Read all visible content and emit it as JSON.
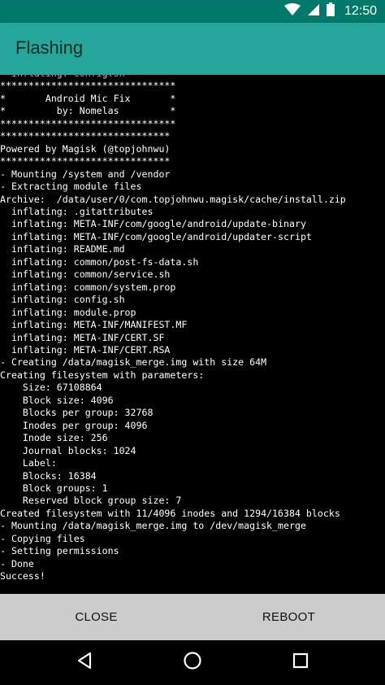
{
  "status_bar": {
    "time": "12:50",
    "icons": [
      "wifi-icon",
      "signal-icon",
      "battery-icon"
    ],
    "color": "#00796b"
  },
  "app_bar": {
    "title": "Flashing",
    "color": "#26a69a"
  },
  "console": {
    "text": "  inflating: config.sh\n*******************************\n*       Android Mic Fix       *\n*         by: Nomelas         *\n*******************************\n******************************\nPowered by Magisk (@topjohnwu)\n******************************\n- Mounting /system and /vendor\n- Extracting module files\nArchive:  /data/user/0/com.topjohnwu.magisk/cache/install.zip\n  inflating: .gitattributes\n  inflating: META-INF/com/google/android/update-binary\n  inflating: META-INF/com/google/android/updater-script\n  inflating: README.md\n  inflating: common/post-fs-data.sh\n  inflating: common/service.sh\n  inflating: common/system.prop\n  inflating: config.sh\n  inflating: module.prop\n  inflating: META-INF/MANIFEST.MF\n  inflating: META-INF/CERT.SF\n  inflating: META-INF/CERT.RSA\n- Creating /data/magisk_merge.img with size 64M\nCreating filesystem with parameters:\n    Size: 67108864\n    Block size: 4096\n    Blocks per group: 32768\n    Inodes per group: 4096\n    Inode size: 256\n    Journal blocks: 1024\n    Label:\n    Blocks: 16384\n    Block groups: 1\n    Reserved block group size: 7\nCreated filesystem with 11/4096 inodes and 1294/16384 blocks\n- Mounting /data/magisk_merge.img to /dev/magisk_merge\n- Copying files\n- Setting permissions\n- Done\nSuccess!"
  },
  "buttons": {
    "close_label": "CLOSE",
    "reboot_label": "REBOOT"
  },
  "nav_bar": {
    "icons": [
      "back-icon",
      "home-icon",
      "recents-icon"
    ]
  }
}
